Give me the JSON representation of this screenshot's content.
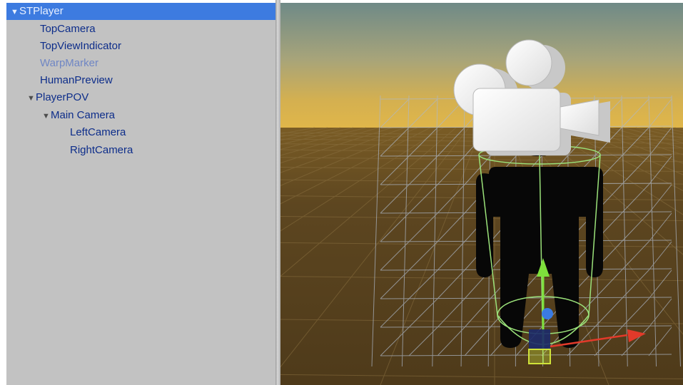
{
  "hierarchy": {
    "items": [
      {
        "label": "STPlayer",
        "expanded": true,
        "selected": true,
        "active": true
      },
      {
        "label": "TopCamera",
        "active": true
      },
      {
        "label": "TopViewIndicator",
        "active": true
      },
      {
        "label": "WarpMarker",
        "active": false
      },
      {
        "label": "HumanPreview",
        "active": true
      },
      {
        "label": "PlayerPOV",
        "expanded": true,
        "active": true
      },
      {
        "label": "Main Camera",
        "expanded": true,
        "active": true
      },
      {
        "label": "LeftCamera",
        "active": true
      },
      {
        "label": "RightCamera",
        "active": true
      }
    ]
  },
  "scene": {
    "icons": [
      "camera-gizmo-icon",
      "human-silhouette-icon",
      "move-gizmo-icon"
    ],
    "colors": {
      "sky_top": "#6f8a87",
      "horizon": "#e0b64a",
      "ground": "#5a4520",
      "selection_wire": "#9be27a",
      "axis_y": "#7ee03c",
      "axis_x": "#e23a2a",
      "axis_z": "#3a7be2"
    }
  }
}
